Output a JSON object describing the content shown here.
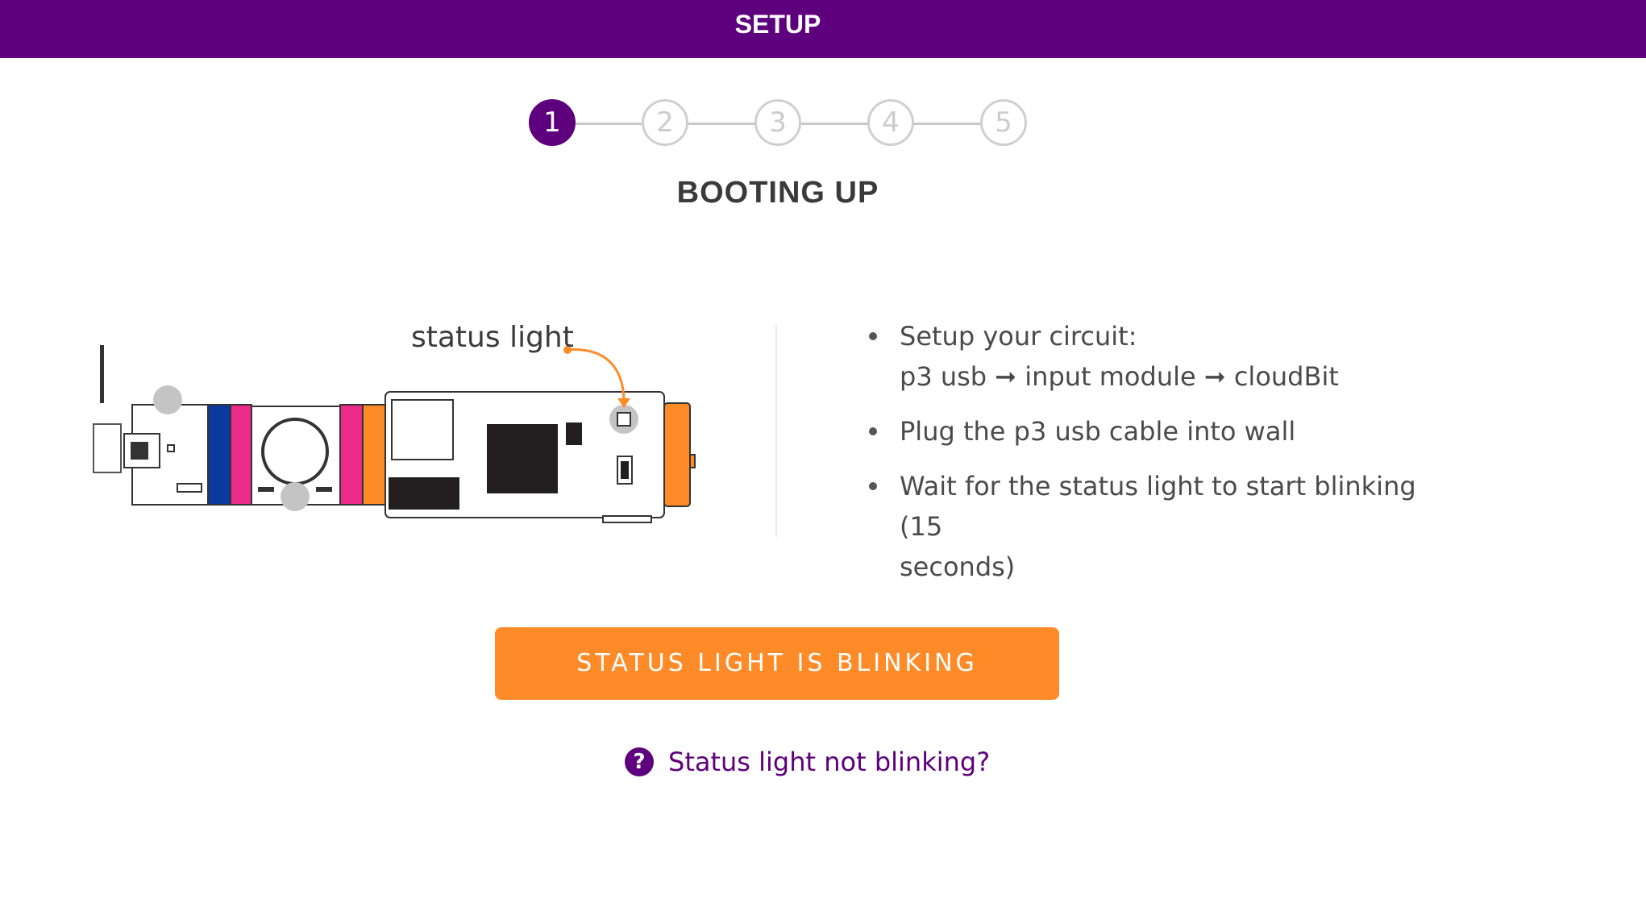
{
  "header": {
    "title": "SETUP"
  },
  "stepper": {
    "steps": [
      "1",
      "2",
      "3",
      "4",
      "5"
    ],
    "active_step": 1
  },
  "page_title": "BOOTING UP",
  "diagram": {
    "status_label": "status light"
  },
  "instructions": {
    "items": [
      {
        "line1": "Setup your circuit:",
        "line2": "p3 usb ➞ input module ➞ cloudBit"
      },
      {
        "line1": "Plug the p3 usb cable into wall",
        "line2": ""
      },
      {
        "line1": "Wait for the status light to start blinking (15",
        "line2": "seconds)"
      }
    ]
  },
  "cta": {
    "label": "STATUS LIGHT IS BLINKING"
  },
  "help": {
    "icon": "question-circle-icon",
    "label": "Status light not blinking?"
  },
  "colors": {
    "brand_purple": "#5e007d",
    "cta_orange": "#ff8a28",
    "module_blue": "#0a3a9e",
    "module_pink": "#ec2a8a"
  }
}
